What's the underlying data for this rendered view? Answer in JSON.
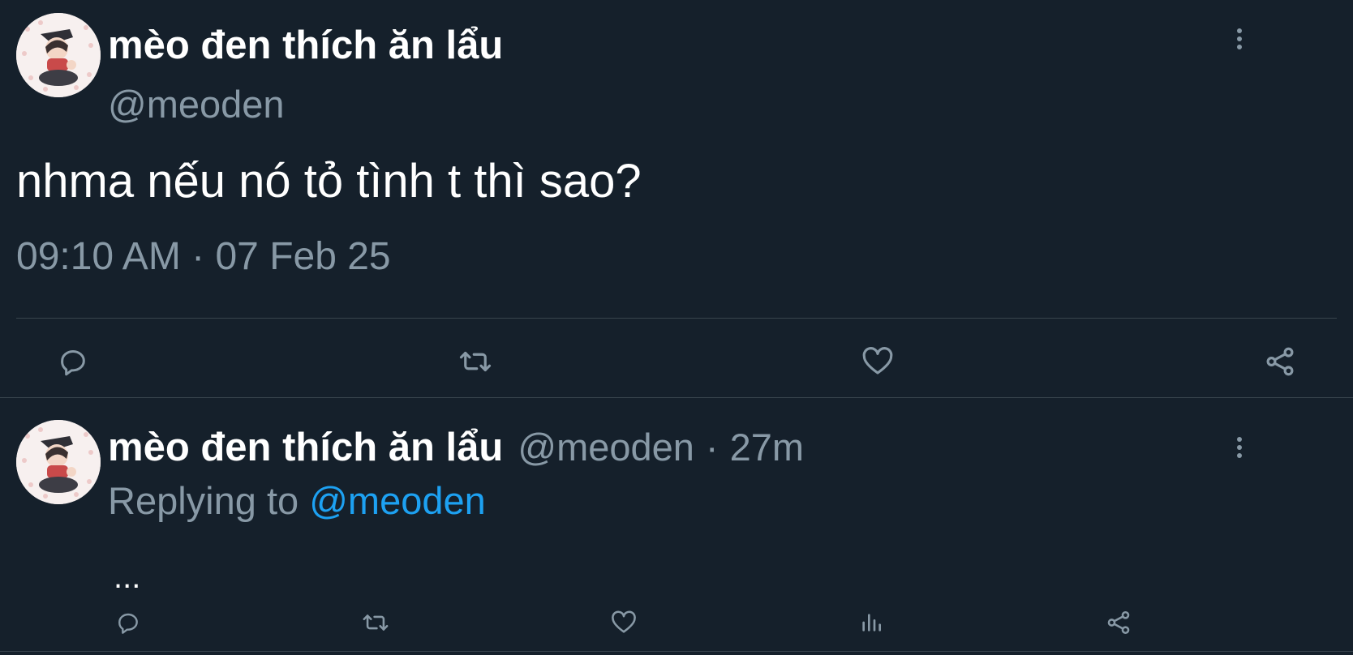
{
  "main_tweet": {
    "author": {
      "display_name": "mèo đen thích ăn lẩu",
      "handle": "@meoden"
    },
    "text": "nhma nếu nó tỏ tình t thì sao?",
    "timestamp": "09:10 AM · 07 Feb 25",
    "actions": [
      {
        "icon": "reply-icon"
      },
      {
        "icon": "retweet-icon"
      },
      {
        "icon": "like-icon"
      },
      {
        "icon": "share-icon"
      }
    ]
  },
  "reply_tweet": {
    "author": {
      "display_name": "mèo đen thích ăn lẩu",
      "handle": "@meoden",
      "separator": "·",
      "relative_time": "27m"
    },
    "replying_prefix": "Replying to",
    "replying_to": "@meoden",
    "text": "...",
    "actions": [
      {
        "icon": "reply-icon"
      },
      {
        "icon": "retweet-icon"
      },
      {
        "icon": "like-icon"
      },
      {
        "icon": "analytics-icon"
      },
      {
        "icon": "share-icon"
      }
    ]
  },
  "colors": {
    "background": "#15202b",
    "primary_text": "#ffffff",
    "secondary_text": "#8899a6",
    "link": "#1da1f2",
    "divider": "#38444d"
  }
}
